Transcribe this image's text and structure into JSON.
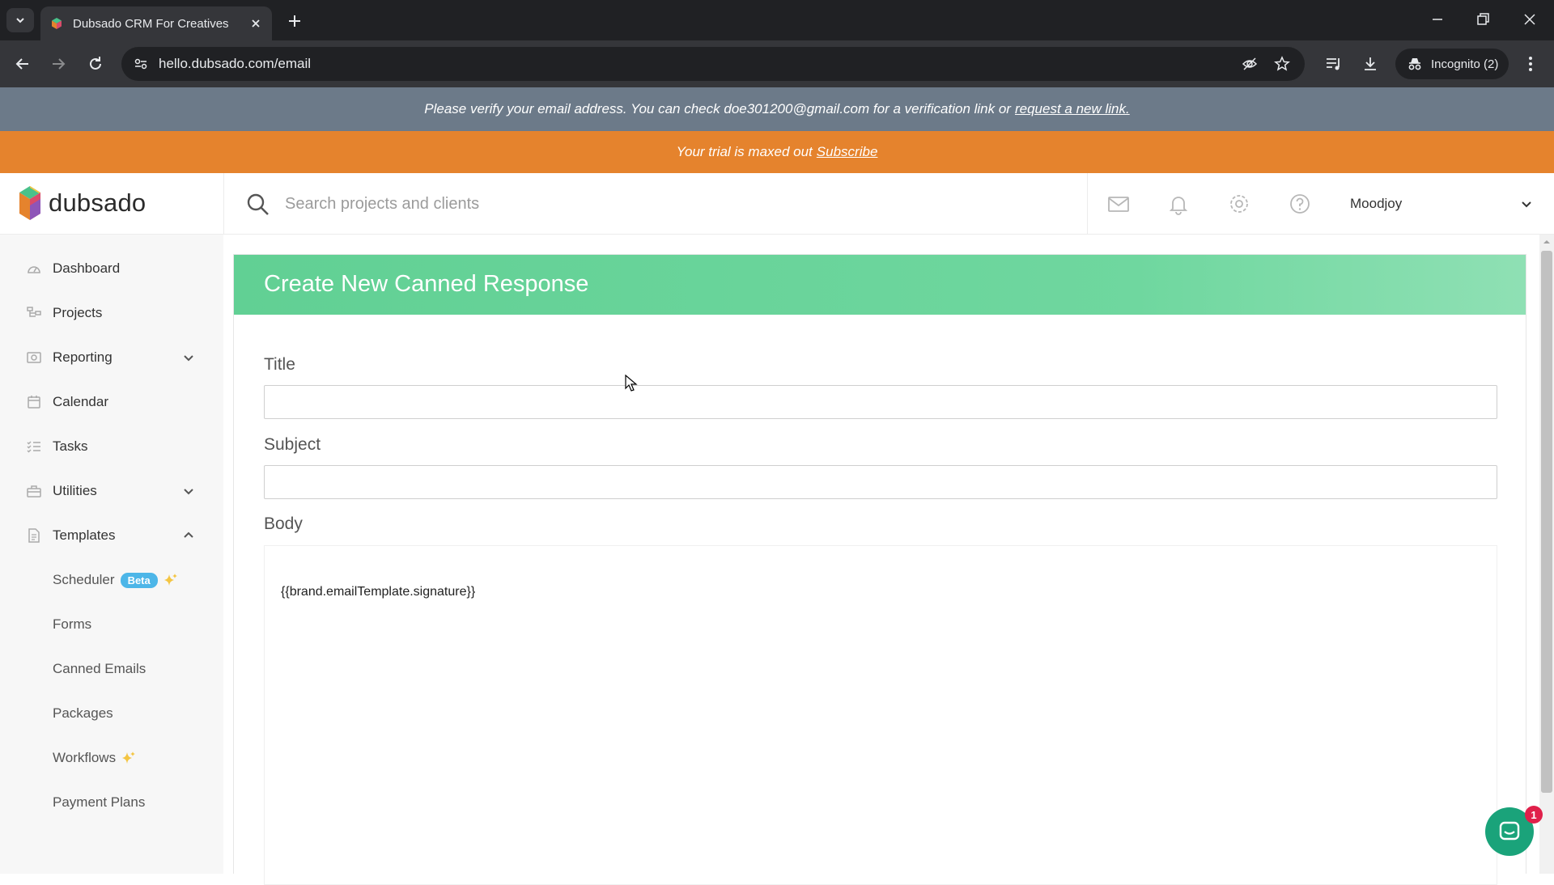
{
  "browser": {
    "tab_title": "Dubsado CRM For Creatives",
    "url": "hello.dubsado.com/email",
    "incognito_label": "Incognito (2)"
  },
  "banners": {
    "verify_text": "Please verify your email address. You can check doe301200@gmail.com for a verification link or",
    "verify_link": "request a new link.",
    "trial_text": "Your trial is maxed out",
    "trial_link": "Subscribe"
  },
  "header": {
    "logo_text": "dubsado",
    "search_placeholder": "Search projects and clients",
    "user_name": "Moodjoy"
  },
  "sidebar": {
    "items": [
      {
        "label": "Dashboard"
      },
      {
        "label": "Projects"
      },
      {
        "label": "Reporting"
      },
      {
        "label": "Calendar"
      },
      {
        "label": "Tasks"
      },
      {
        "label": "Utilities"
      },
      {
        "label": "Templates"
      }
    ],
    "sub_items": [
      {
        "label": "Scheduler",
        "badge": "Beta"
      },
      {
        "label": "Forms"
      },
      {
        "label": "Canned Emails"
      },
      {
        "label": "Packages"
      },
      {
        "label": "Workflows"
      },
      {
        "label": "Payment Plans"
      }
    ]
  },
  "form": {
    "title": "Create New Canned Response",
    "title_label": "Title",
    "title_value": "",
    "subject_label": "Subject",
    "subject_value": "",
    "body_label": "Body",
    "body_text": "{{brand.emailTemplate.signature}}"
  },
  "chat": {
    "badge_count": "1"
  },
  "colors": {
    "header_green": "#61d094",
    "trial_orange": "#e5832d",
    "verify_gray": "#6c7a89",
    "beta_blue": "#4db6e8"
  }
}
